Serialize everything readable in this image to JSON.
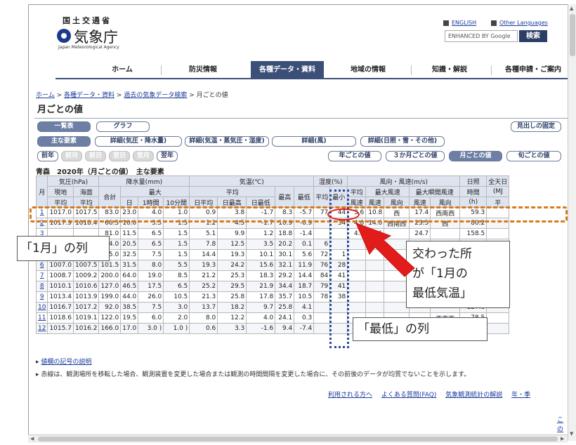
{
  "header": {
    "agency_small": "国土交通省",
    "agency_big": "気象庁",
    "agency_en": "Japan Meteorological Agency",
    "english_link": "ENGLISH",
    "other_lang_link": "Other Languages",
    "search_placeholder": "ENHANCED BY Google",
    "search_button": "検索"
  },
  "nav": {
    "items": [
      "ホーム",
      "防災情報",
      "各種データ・資料",
      "地域の情報",
      "知識・解説",
      "各種申請・ご案内"
    ],
    "active_index": 2
  },
  "breadcrumb": {
    "items": [
      "ホーム",
      "各種データ・資料",
      "過去の気象データ検索"
    ],
    "current": "月ごとの値",
    "separator": ">"
  },
  "page_title": "月ごとの値",
  "buttons": {
    "list": "一覧表",
    "graph": "グラフ",
    "fixed_heading": "見出しの固定",
    "main_elements": "主な要素",
    "detail_pressure": "詳細(気圧・降水量)",
    "detail_temp": "詳細(気温・蒸気圧・湿度)",
    "detail_wind": "詳細(風)",
    "detail_sun": "詳細(日照・雪・その他)",
    "prev_year": "前年",
    "prev_month": "前月",
    "prev_day": "前日",
    "next_day": "翌日",
    "next_month": "翌月",
    "next_year": "翌年",
    "yearly": "年ごとの値",
    "three_month": "３か月ごとの値",
    "monthly": "月ごとの値",
    "ten_day": "旬ごとの値"
  },
  "table_heading": "青森　2020年（月ごとの値）　主な要素",
  "table": {
    "h1": {
      "month": "月",
      "pressure": "気圧(hPa)",
      "precip": "降水量(mm)",
      "temp": "気温(℃)",
      "humidity": "湿度(%)",
      "wind": "風向・風速(m/s)",
      "sun1": "日照",
      "sun2": "時間",
      "sun3": "(h)",
      "solar": "全天日",
      "solar2": "(MJ"
    },
    "h2": {
      "local": "現地",
      "sea": "海面",
      "total": "合計",
      "max": "最大",
      "avg": "平均",
      "tmax": "最高",
      "tmin": "最低",
      "hum_avg": "平均",
      "hum_min": "最小",
      "wind_avg": "平均",
      "max_wind": "最大風速",
      "max_gust": "最大瞬間風速"
    },
    "h3": {
      "local_avg": "平均",
      "sea_avg": "平均",
      "day": "日",
      "hour": "1時間",
      "ten": "10分間",
      "davg": "日平均",
      "dmax": "日最高",
      "dmin": "日最低",
      "ws": "風速",
      "spd": "風速",
      "dir": "風向",
      "gspd": "風速",
      "gdir": "風向",
      "solar_avg": "平"
    },
    "rows": [
      [
        "1",
        "1017.0",
        "1017.5",
        "83.0",
        "23.0",
        "4.0",
        "1.0",
        "0.9",
        "3.8",
        "-1.7",
        "8.3",
        "-5.7",
        "77",
        "44",
        "3.6",
        "10.8",
        "西",
        "17.4",
        "西南西",
        "59.3"
      ],
      [
        "2",
        "1017.9",
        "1018.4",
        "66.5",
        "10.0",
        "3.5",
        "1.5",
        "1.2",
        "4.5",
        "-1.7",
        "10.9",
        "-6.9",
        "",
        "34",
        "4.0",
        "14.0",
        "西南西",
        "23.5",
        "西",
        "80.2"
      ],
      [
        "3",
        "",
        "",
        "81.0",
        "11.5",
        "6.5",
        "1.5",
        "5.1",
        "9.9",
        "1.2",
        "18.8",
        "-1.4",
        "",
        "",
        "4.1",
        "16.6",
        "",
        "24.7",
        "",
        "158.5"
      ],
      [
        "4",
        "",
        "",
        "04.0",
        "20.5",
        "6.5",
        "1.5",
        "7.8",
        "12.5",
        "3.5",
        "20.2",
        "0.1",
        "6",
        "",
        "",
        "",
        "",
        "",
        "西",
        "139.0"
      ],
      [
        "5",
        "",
        "",
        "75.0",
        "32.5",
        "7.5",
        "1.5",
        "14.4",
        "19.3",
        "10.1",
        "30.1",
        "5.6",
        "72",
        "1",
        "",
        "",
        "",
        "",
        "西",
        "182.7"
      ],
      [
        "6",
        "1007.0",
        "1007.5",
        "101.5",
        "31.5",
        "8.0",
        "5.5",
        "19.3",
        "24.2",
        "15.6",
        "32.1",
        "11.9",
        "76",
        "28",
        "",
        "",
        "",
        "",
        "西",
        "210.0"
      ],
      [
        "7",
        "1008.7",
        "1009.2",
        "200.0",
        "64.0",
        "19.0",
        "8.5",
        "21.2",
        "25.3",
        "18.3",
        "29.2",
        "14.4",
        "84",
        "41",
        "",
        "",
        "",
        "",
        "東",
        "167.3"
      ],
      [
        "8",
        "1010.1",
        "1010.6",
        "127.0",
        "46.5",
        "17.5",
        "6.5",
        "25.2",
        "29.5",
        "21.9",
        "34.4",
        "18.7",
        "79",
        "41",
        "",
        "",
        "",
        "",
        "西",
        "178.4"
      ],
      [
        "9",
        "1013.4",
        "1013.9",
        "199.0",
        "44.0",
        "26.0",
        "10.5",
        "21.3",
        "25.8",
        "17.8",
        "35.7",
        "10.5",
        "78",
        "38",
        "",
        "",
        "",
        "",
        "",
        "172.8"
      ],
      [
        "10",
        "1016.7",
        "1017.2",
        "92.0",
        "38.5",
        "7.5",
        "3.0",
        "13.7",
        "18.2",
        "9.7",
        "25.8",
        "4.1",
        "",
        "",
        "",
        "",
        "",
        "",
        "",
        "127.6"
      ],
      [
        "11",
        "1018.6",
        "1019.1",
        "122.0",
        "19.5",
        "6.0",
        "2.0",
        "8.0",
        "12.2",
        "4.0",
        "24.1",
        "0.3",
        "",
        "",
        "",
        "",
        "",
        "",
        "西南西",
        "78.5"
      ],
      [
        "12",
        "1015.7",
        "1016.2",
        "166.0",
        "17.0",
        "3.0 )",
        "1.0 )",
        "0.6",
        "3.3",
        "-1.6",
        "9.4",
        "-7.4",
        "",
        "",
        "",
        "",
        "",
        "",
        "西",
        "44.6"
      ]
    ]
  },
  "notes": {
    "link": "値欄の記号の説明",
    "text": "赤線は、観測場所を移転した場合、観測装置を変更した場合または観測の時間間隔を変更した場合に、その前後のデータが均質でないことを示します。"
  },
  "footer_links": [
    "利用される方へ",
    "よくある質問(FAQ)",
    "気象観測統計の解説",
    "年・季"
  ],
  "footer_more": "この",
  "annotations": {
    "row_label": "「1月」の列",
    "col_label": "「最低」の列",
    "callout": "交わった所\nが「1月の\n最低気温」"
  },
  "colors": {
    "nav_active": "#3b4f78",
    "row_highlight": "#d77b1a",
    "col_highlight": "#2a4a9a",
    "circle": "#e21b1b",
    "arrow": "#e21b1b"
  }
}
